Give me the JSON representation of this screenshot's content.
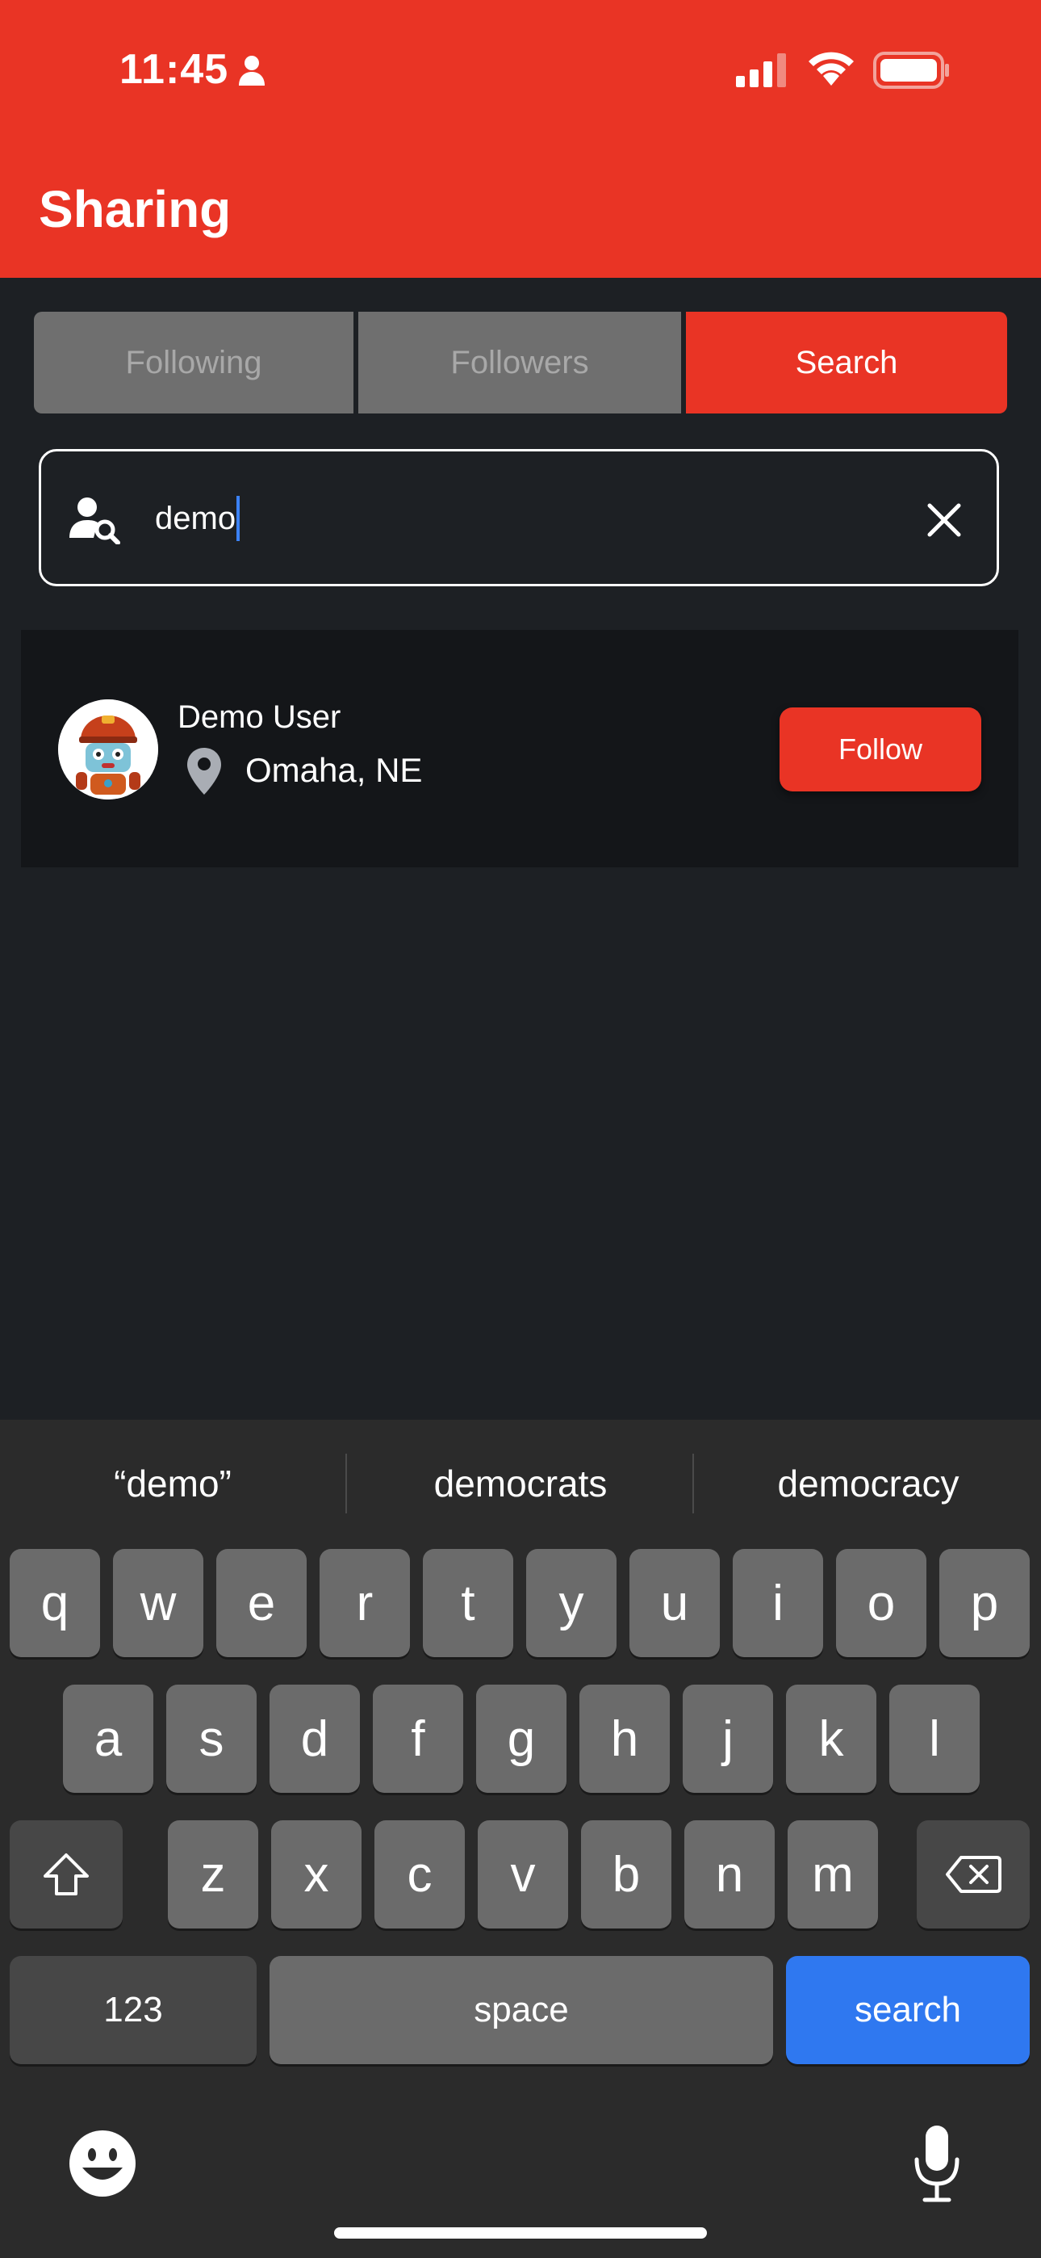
{
  "status_bar": {
    "time": "11:45"
  },
  "header": {
    "title": "Sharing"
  },
  "tabs": [
    {
      "label": "Following",
      "active": false
    },
    {
      "label": "Followers",
      "active": false
    },
    {
      "label": "Search",
      "active": true
    }
  ],
  "search": {
    "value": "demo"
  },
  "results": [
    {
      "name": "Demo User",
      "location": "Omaha, NE",
      "action": "Follow"
    }
  ],
  "keyboard": {
    "suggestions": [
      "“demo”",
      "democrats",
      "democracy"
    ],
    "row1": [
      "q",
      "w",
      "e",
      "r",
      "t",
      "y",
      "u",
      "i",
      "o",
      "p"
    ],
    "row2": [
      "a",
      "s",
      "d",
      "f",
      "g",
      "h",
      "j",
      "k",
      "l"
    ],
    "row3": [
      "z",
      "x",
      "c",
      "v",
      "b",
      "n",
      "m"
    ],
    "numbers_label": "123",
    "space_label": "space",
    "search_label": "search"
  },
  "colors": {
    "accent": "#e93425",
    "background": "#1d2024",
    "card": "#141619",
    "keyboard_action": "#2f78f0"
  },
  "icons": [
    "person-icon",
    "signal-icon",
    "wifi-icon",
    "battery-icon",
    "search-user-icon",
    "clear-icon",
    "pin-icon",
    "shift-icon",
    "backspace-icon",
    "emoji-icon",
    "mic-icon"
  ]
}
